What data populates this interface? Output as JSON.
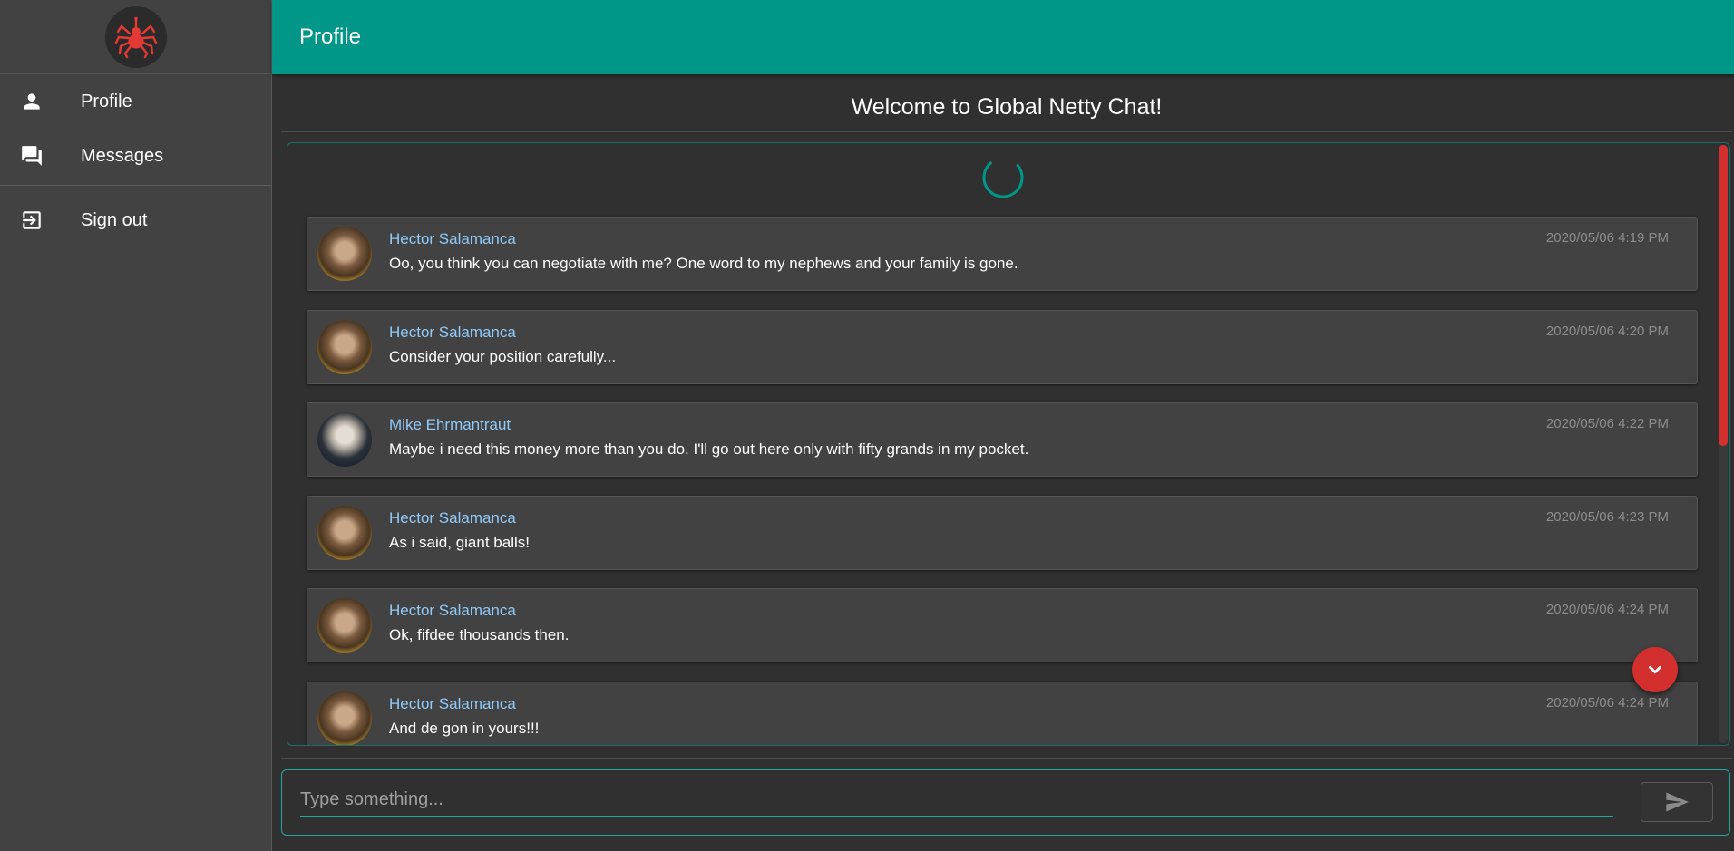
{
  "sidebar": {
    "logo": "spider-logo",
    "items": [
      {
        "label": "Profile",
        "icon": "person-icon"
      },
      {
        "label": "Messages",
        "icon": "chat-icon"
      },
      {
        "label": "Sign out",
        "icon": "sign-out-icon"
      }
    ]
  },
  "topbar": {
    "title": "Profile"
  },
  "main": {
    "welcome": "Welcome to Global Netty Chat!",
    "messages": [
      {
        "author": "Hector Salamanca",
        "time": "2020/05/06 4:19 PM",
        "text": "Oo, you think you can negotiate with me? One word to my nephews and your family is gone."
      },
      {
        "author": "Hector Salamanca",
        "time": "2020/05/06 4:20 PM",
        "text": "Consider your position carefully..."
      },
      {
        "author": "Mike Ehrmantraut",
        "time": "2020/05/06 4:22 PM",
        "text": "Maybe i need this money more than you do. I'll go out here only with fifty grands in my pocket."
      },
      {
        "author": "Hector Salamanca",
        "time": "2020/05/06 4:23 PM",
        "text": "As i said, giant balls!"
      },
      {
        "author": "Hector Salamanca",
        "time": "2020/05/06 4:24 PM",
        "text": "Ok, fifdee thousands then."
      },
      {
        "author": "Hector Salamanca",
        "time": "2020/05/06 4:24 PM",
        "text": "And de gon in yours!!!"
      }
    ]
  },
  "composer": {
    "placeholder": "Type something...",
    "value": ""
  },
  "colors": {
    "accent": "#009688",
    "danger": "#d32f2f",
    "author": "#90caf9",
    "background": "#303030",
    "sidebar": "#424242"
  }
}
